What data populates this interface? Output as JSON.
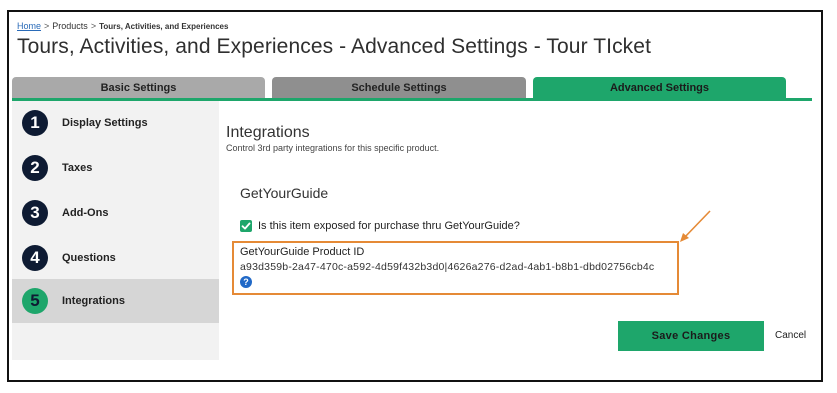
{
  "breadcrumb": {
    "home": "Home",
    "sep1": ">",
    "products": "Products",
    "sep2": ">",
    "current": "Tours, Activities, and Experiences"
  },
  "page_title": "Tours, Activities, and Experiences - Advanced Settings - Tour TIcket",
  "tabs": [
    {
      "label": "Basic Settings",
      "active": false
    },
    {
      "label": "Schedule Settings",
      "active": false
    },
    {
      "label": "Advanced Settings",
      "active": true
    }
  ],
  "steps": [
    {
      "num": "1",
      "label": "Display Settings"
    },
    {
      "num": "2",
      "label": "Taxes"
    },
    {
      "num": "3",
      "label": "Add-Ons"
    },
    {
      "num": "4",
      "label": "Questions"
    },
    {
      "num": "5",
      "label": "Integrations",
      "active": true
    }
  ],
  "integrations": {
    "title": "Integrations",
    "subtitle": "Control 3rd party integrations for this specific product.",
    "provider": "GetYourGuide",
    "checkbox_label": "Is this item exposed for purchase thru GetYourGuide?",
    "checkbox_checked": true,
    "product_id_label": "GetYourGuide Product ID",
    "product_id_value": "a93d359b-2a47-470c-a592-4d59f432b3d0|4626a276-d2ad-4ab1-b8b1-dbd02756cb4c",
    "help_glyph": "?"
  },
  "actions": {
    "save": "Save Changes",
    "cancel": "Cancel"
  },
  "colors": {
    "accent": "#1ea66b",
    "step_circle": "#0e1b33",
    "highlight": "#e58a36",
    "link": "#2a6bb8"
  }
}
